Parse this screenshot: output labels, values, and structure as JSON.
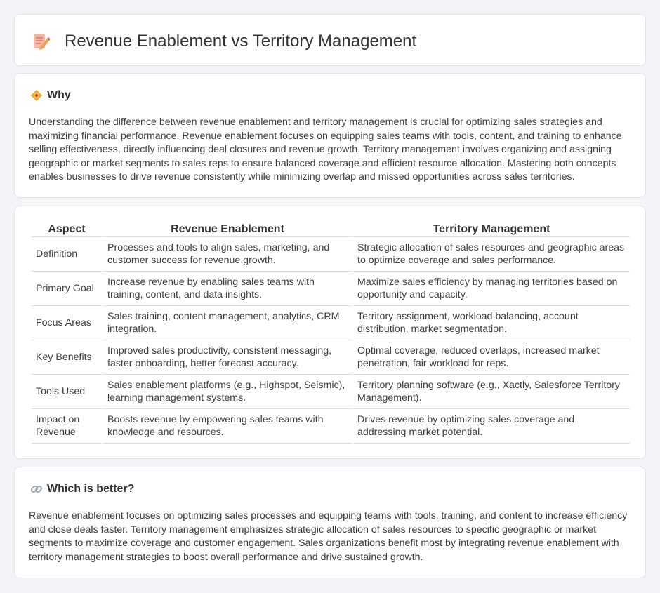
{
  "header": {
    "title": "Revenue Enablement vs Territory Management",
    "icon": "document-pencil-icon"
  },
  "why": {
    "heading": "Why",
    "icon": "diamond-sign-icon",
    "text": "Understanding the difference between revenue enablement and territory management is crucial for optimizing sales strategies and maximizing financial performance. Revenue enablement focuses on equipping sales teams with tools, content, and training to enhance selling effectiveness, directly influencing deal closures and revenue growth. Territory management involves organizing and assigning geographic or market segments to sales reps to ensure balanced coverage and efficient resource allocation. Mastering both concepts enables businesses to drive revenue consistently while minimizing overlap and missed opportunities across sales territories."
  },
  "table": {
    "headers": [
      "Aspect",
      "Revenue Enablement",
      "Territory Management"
    ],
    "rows": [
      [
        "Definition",
        "Processes and tools to align sales, marketing, and customer success for revenue growth.",
        "Strategic allocation of sales resources and geographic areas to optimize coverage and sales performance."
      ],
      [
        "Primary Goal",
        "Increase revenue by enabling sales teams with training, content, and data insights.",
        "Maximize sales efficiency by managing territories based on opportunity and capacity."
      ],
      [
        "Focus Areas",
        "Sales training, content management, analytics, CRM integration.",
        "Territory assignment, workload balancing, account distribution, market segmentation."
      ],
      [
        "Key Benefits",
        "Improved sales productivity, consistent messaging, faster onboarding, better forecast accuracy.",
        "Optimal coverage, reduced overlaps, increased market penetration, fair workload for reps."
      ],
      [
        "Tools Used",
        "Sales enablement platforms (e.g., Highspot, Seismic), learning management systems.",
        "Territory planning software (e.g., Xactly, Salesforce Territory Management)."
      ],
      [
        "Impact on Revenue",
        "Boosts revenue by empowering sales teams with knowledge and resources.",
        "Drives revenue by optimizing sales coverage and addressing market potential."
      ]
    ]
  },
  "better": {
    "heading": "Which is better?",
    "icon": "link-icon",
    "text": "Revenue enablement focuses on optimizing sales processes and equipping teams with tools, training, and content to increase efficiency and close deals faster. Territory management emphasizes strategic allocation of sales resources to specific geographic or market segments to maximize coverage and customer engagement. Sales organizations benefit most by integrating revenue enablement with territory management strategies to boost overall performance and drive sustained growth."
  }
}
